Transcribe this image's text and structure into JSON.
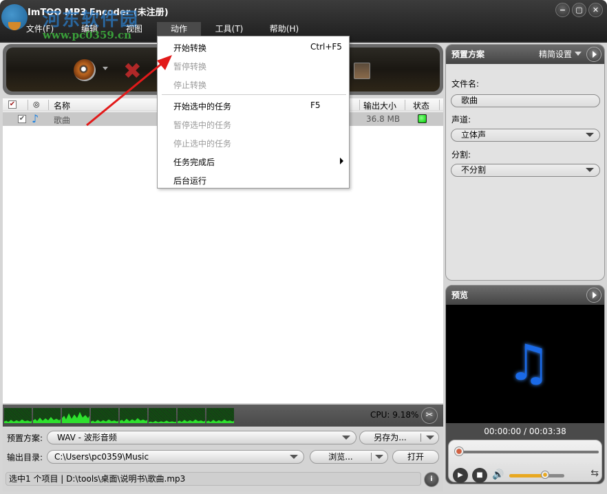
{
  "window": {
    "title": "ImTOO MP3 Encoder (未注册)",
    "controls": {
      "minimize": "−",
      "maximize": "▢",
      "close": "✕"
    }
  },
  "watermark": {
    "line1": "河东软件园",
    "line2": "www.pc0359.cn"
  },
  "menubar": {
    "items": [
      {
        "label": "文件(F)"
      },
      {
        "label": "编辑"
      },
      {
        "label": "视图"
      },
      {
        "label": "动作"
      },
      {
        "label": "工具(T)"
      },
      {
        "label": "帮助(H)"
      }
    ],
    "active_index": 3
  },
  "action_menu": {
    "items": [
      {
        "label": "开始转换",
        "shortcut": "Ctrl+F5",
        "enabled": true
      },
      {
        "label": "暂停转换",
        "shortcut": "",
        "enabled": false
      },
      {
        "label": "停止转换",
        "shortcut": "",
        "enabled": false
      },
      {
        "label": "开始选中的任务",
        "shortcut": "F5",
        "enabled": true
      },
      {
        "label": "暂停选中的任务",
        "shortcut": "",
        "enabled": false
      },
      {
        "label": "停止选中的任务",
        "shortcut": "",
        "enabled": false
      },
      {
        "label": "任务完成后",
        "shortcut": "",
        "enabled": true,
        "submenu": true
      },
      {
        "label": "后台运行",
        "shortcut": "",
        "enabled": true
      }
    ]
  },
  "toolbar": {
    "add_file_icon": "cd-music-icon",
    "delete_icon": "delete-x-icon",
    "check": "✔",
    "delete_glyph": "✖"
  },
  "file_list": {
    "columns": {
      "name": "名称",
      "output_size": "输出大小",
      "status": "状态"
    },
    "rows": [
      {
        "checked": true,
        "name": "歌曲",
        "output_size": "36.8 MB",
        "status": "ready",
        "status_color": "#00cc00"
      }
    ],
    "note_glyph": "♪"
  },
  "wave_levels": [
    0.25,
    0.45,
    0.8,
    0.25,
    0.35,
    0.2,
    0.25,
    0.25
  ],
  "cpu": {
    "text": "CPU: 9.18%"
  },
  "bottom": {
    "preset_label": "预置方案:",
    "preset_value": "WAV - 波形音频",
    "save_as_label": "另存为...",
    "output_label": "输出目录:",
    "output_value": "C:\\Users\\pc0359\\Music",
    "browse_label": "浏览...",
    "open_label": "打开",
    "status_text": "选中1 个项目 | D:\\tools\\桌面\\说明书\\歌曲.mp3",
    "tool_glyph": "✂",
    "info_glyph": "i"
  },
  "preset_panel": {
    "title": "预置方案",
    "mode": "精简设置",
    "filename_label": "文件名:",
    "filename_value": "歌曲",
    "channel_label": "声道:",
    "channel_value": "立体声",
    "split_label": "分割:",
    "split_value": "不分割"
  },
  "preview_panel": {
    "title": "预览",
    "time": "00:00:00 / 00:03:38",
    "seek_progress": 0.0,
    "volume": 0.65,
    "note_glyph": "♫",
    "play_glyph": "▶",
    "stop_glyph": "■",
    "volume_glyph": "🔊",
    "snapshot_glyph": "⇆"
  }
}
